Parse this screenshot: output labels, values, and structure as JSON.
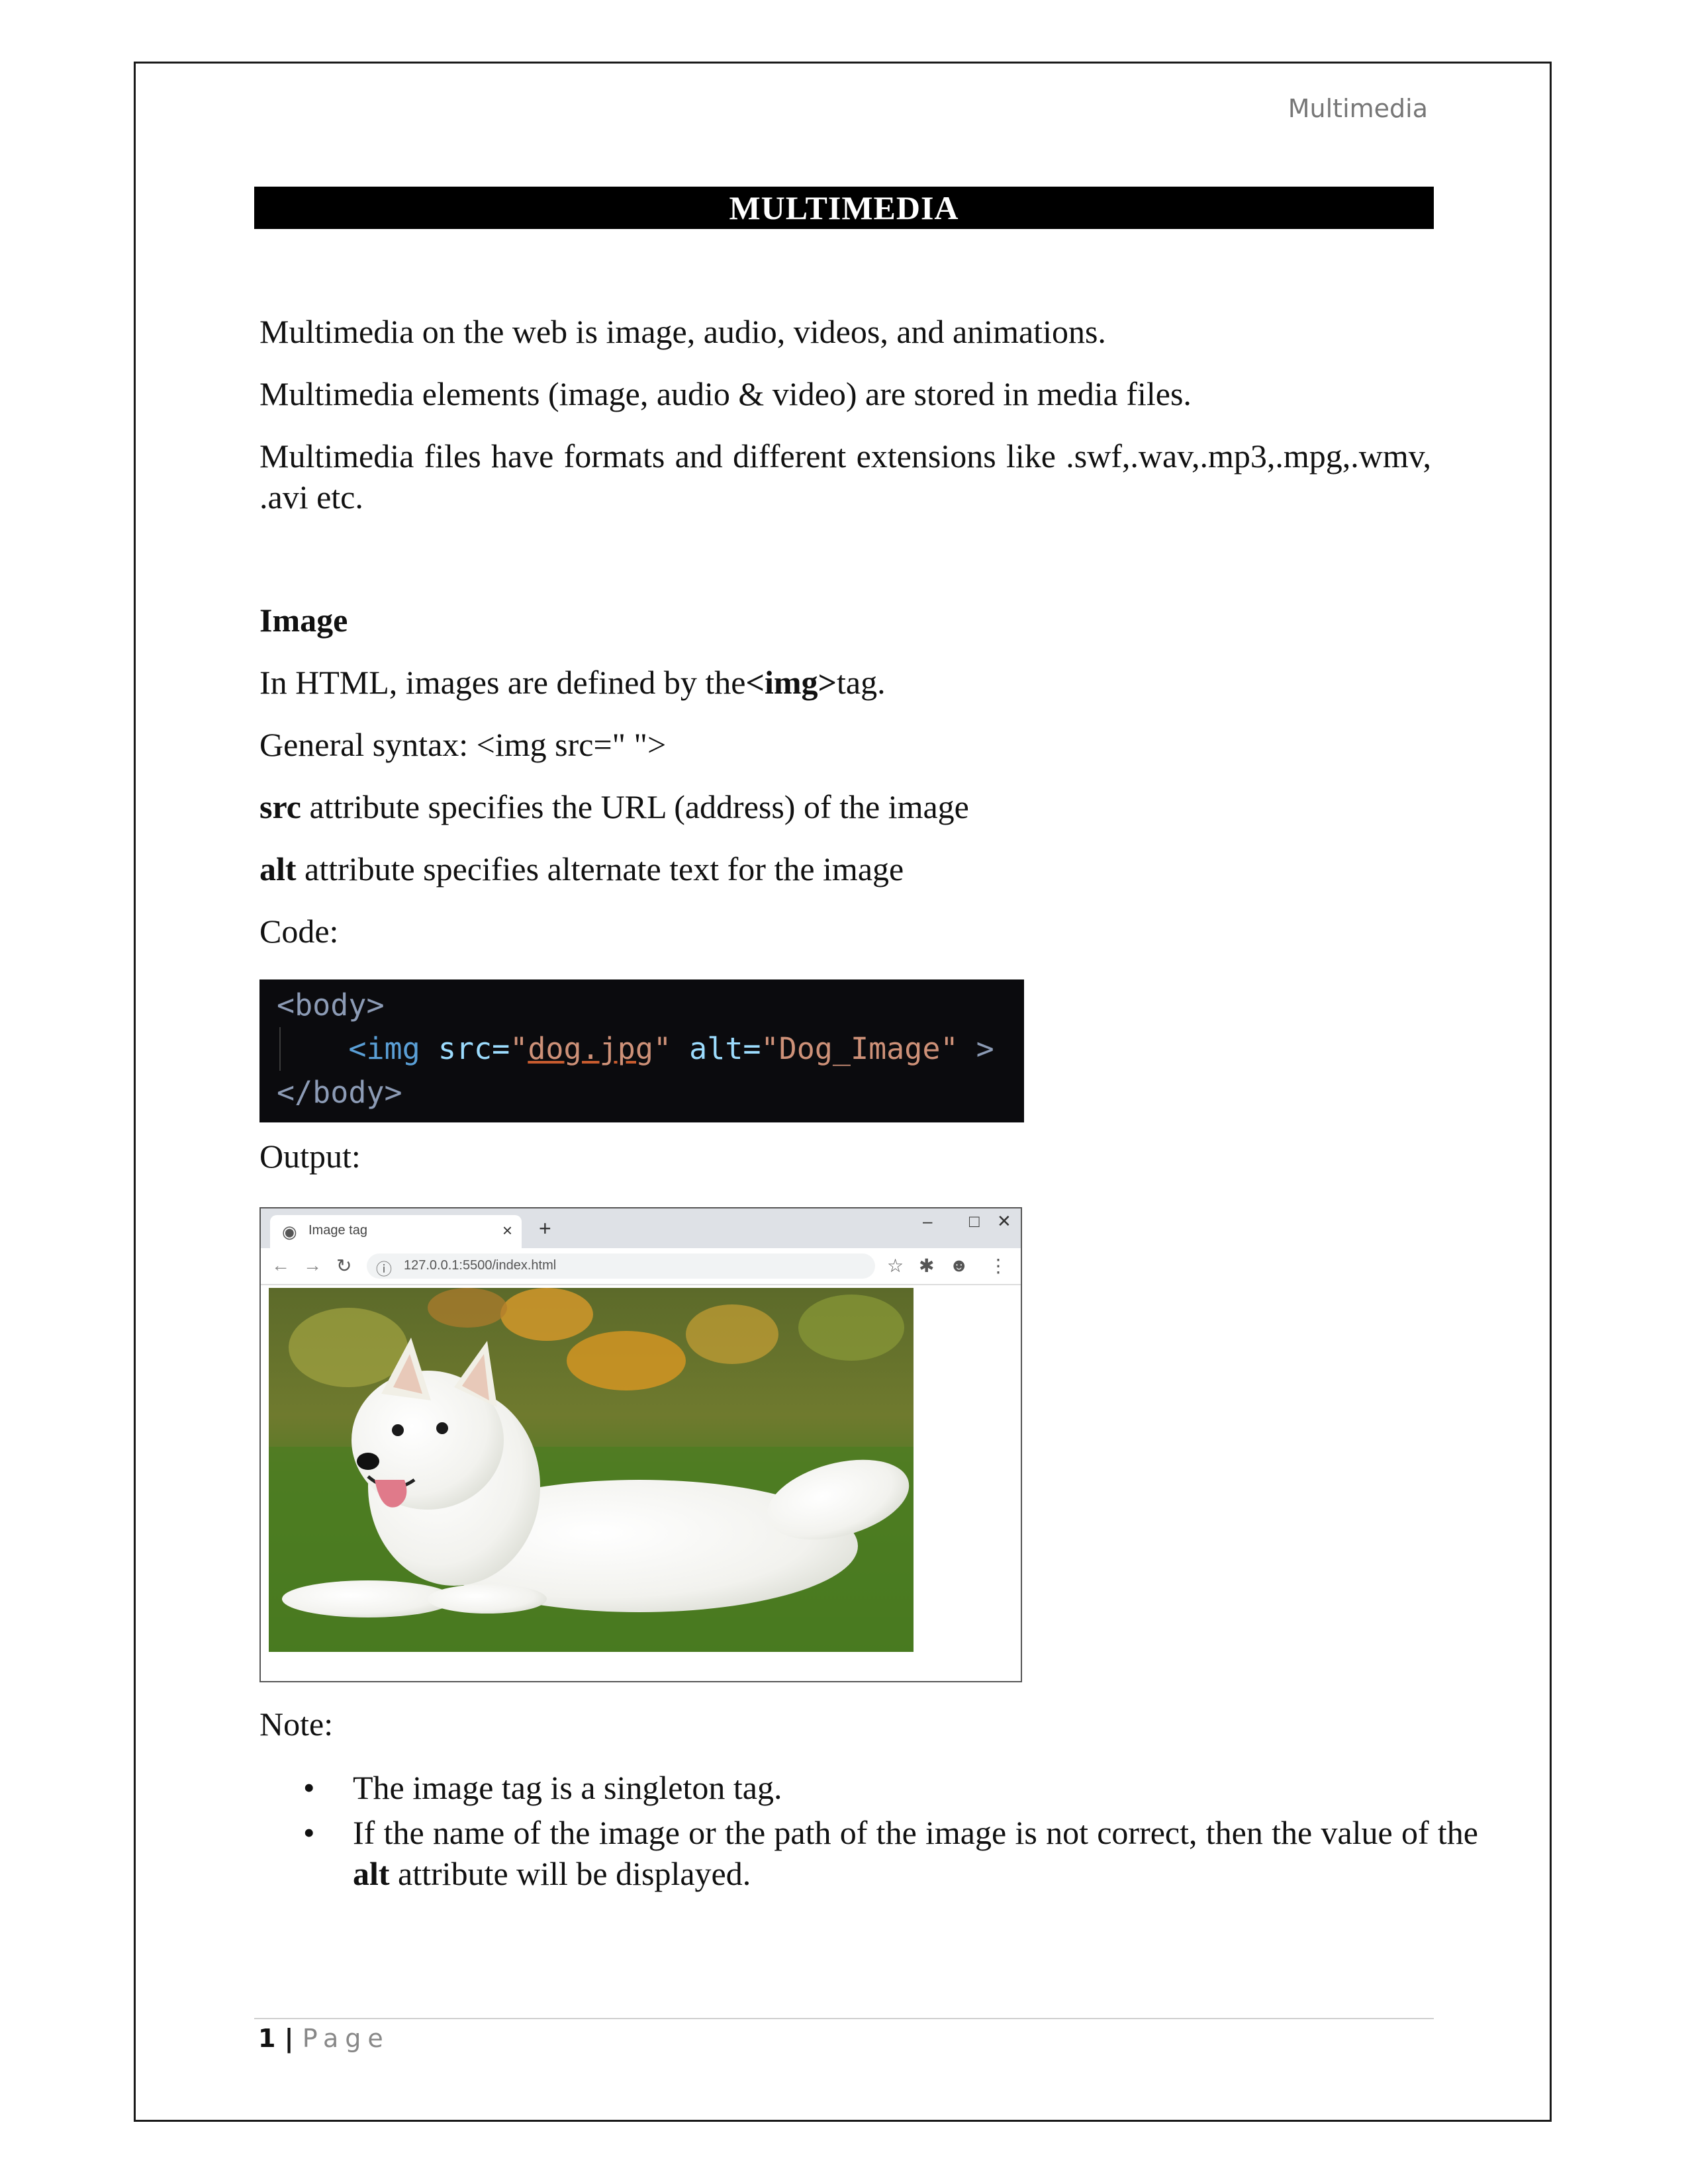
{
  "header": {
    "running_title": "Multimedia"
  },
  "title": "MULTIMEDIA",
  "intro": {
    "p1": "Multimedia on the web is image, audio, videos, and animations.",
    "p2": "Multimedia elements (image, audio  & video) are stored in media files.",
    "p3": "Multimedia files have formats and different extensions like .swf,.wav,.mp3,.mpg,.wmv, .avi  etc."
  },
  "image_section": {
    "heading": "Image",
    "defined_pre": "In HTML, images are defined by the",
    "defined_tag": "<img>",
    "defined_post": "tag.",
    "syntax": "General syntax: <img src=\" \">",
    "src_term": "src",
    "src_desc": " attribute specifies the URL (address) of the image",
    "alt_term": "alt",
    "alt_desc": " attribute specifies alternate text for the image",
    "code_label": "Code:",
    "output_label": "Output:"
  },
  "code": {
    "open_tag": "<body>",
    "img_open": "<img",
    "src_attr": "src=",
    "src_quote": "\"",
    "src_value": "dog.jpg",
    "alt_attr": "alt=",
    "alt_value": "\"Dog_Image\"",
    "img_close": ">",
    "close_tag": "</body>"
  },
  "browser": {
    "tab_title": "Image tag",
    "tab_close": "×",
    "new_tab": "+",
    "minimize": "–",
    "maximize": "□",
    "close": "✕",
    "url": "127.0.0.1:5500/index.html",
    "icons": [
      "globe-icon",
      "back-icon",
      "forward-icon",
      "reload-icon",
      "info-icon",
      "star-icon",
      "extensions-icon",
      "account-icon",
      "menu-icon"
    ]
  },
  "note": {
    "label": "Note:",
    "bullet1": "The image tag is a singleton tag.",
    "bullet2_pre": "If the name of the image or the path of the image is not correct, then the value of the ",
    "bullet2_term": "alt",
    "bullet2_post": " attribute will be displayed."
  },
  "footer": {
    "page_number": "1",
    "separator": " | ",
    "page_word": "Page"
  }
}
